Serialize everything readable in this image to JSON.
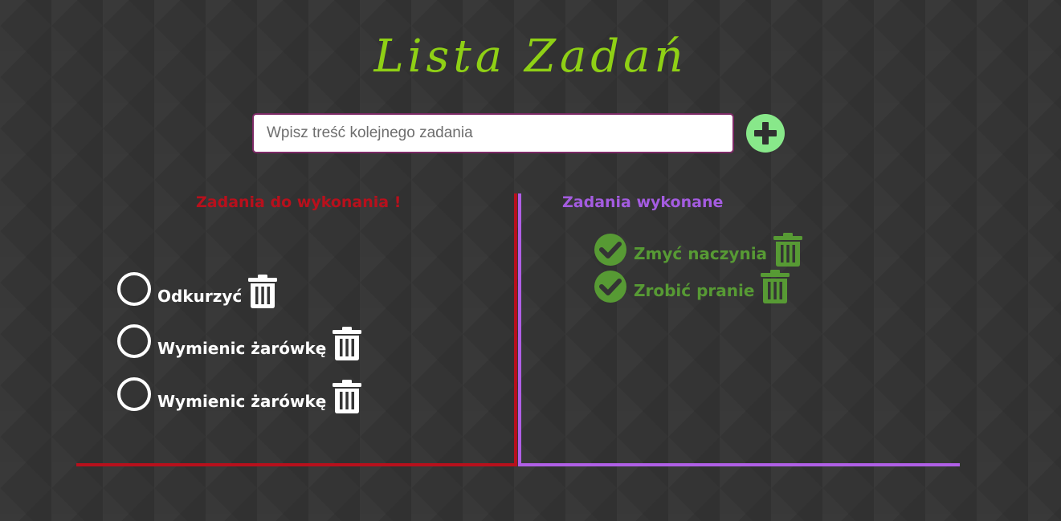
{
  "title": "Lista Zadań",
  "input": {
    "placeholder": "Wpisz treść kolejnego zadania",
    "value": ""
  },
  "add_button": {
    "icon": "plus-circle-icon",
    "color": "#88e88a"
  },
  "pending": {
    "heading": "Zadania do wykonania !",
    "color": "#b8101c",
    "items": [
      {
        "label": "Odkurzyć"
      },
      {
        "label": "Wymienic żarówkę"
      },
      {
        "label": "Wymienic żarówkę"
      }
    ]
  },
  "done": {
    "heading": "Zadania wykonane",
    "color": "#a45ce0",
    "items": [
      {
        "label": "Zmyć naczynia"
      },
      {
        "label": "Zrobić pranie"
      }
    ]
  },
  "colors": {
    "background": "#343434",
    "title": "#8fd015",
    "done_item": "#579a34",
    "pending_item": "#ffffff"
  }
}
